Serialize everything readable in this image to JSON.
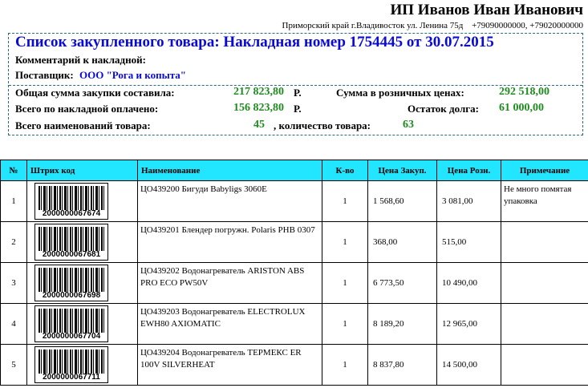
{
  "header": {
    "owner": "ИП Иванов Иван Иванович",
    "address": "Приморский край г.Владивосток ул. Ленина 75д",
    "phones": "+79090000000, +79020000000"
  },
  "invoice": {
    "title": "Список закупленного товара: Накладная номер 1754445 от 30.07.2015",
    "comment_label": "Комментарий к накладной:",
    "supplier_label": "Поставщик:",
    "supplier_value": "ООО \"Рога и копыта\""
  },
  "summary": {
    "total_purchase_label": "Общая сумма закупки составила:",
    "total_purchase_value": "217 823,80",
    "total_purchase_currency": "Р.",
    "retail_label": "Сумма в розничных ценах:",
    "retail_value": "292 518,00",
    "paid_label": "Всего по накладной оплачено:",
    "paid_value": "156 823,80",
    "paid_currency": "Р.",
    "debt_label": "Остаток долга:",
    "debt_value": "61 000,00",
    "items_label": "Всего наименований товара:",
    "items_value": "45",
    "qty_label": ", количество товара:",
    "qty_value": "63"
  },
  "table": {
    "columns": [
      "№",
      "Штрих код",
      "Наименование",
      "К-во",
      "Цена Закуп.",
      "Цена Розн.",
      "Примечание"
    ],
    "rows": [
      {
        "n": "1",
        "barcode": "2000000067674",
        "name": "ЦО439200 Бигуди Babyligs 3060E",
        "qty": "1",
        "buy": "1 568,60",
        "retail": "3 081,00",
        "note": "Не много помятая упаковка"
      },
      {
        "n": "2",
        "barcode": "2000000067681",
        "name": "ЦО439201 Блендер погружн. Polaris PHB 0307",
        "qty": "1",
        "buy": "368,00",
        "retail": "515,00",
        "note": ""
      },
      {
        "n": "3",
        "barcode": "2000000067698",
        "name": "ЦО439202 Водонагреватель ARISTON ABS PRO ECO PW50V",
        "qty": "1",
        "buy": "6 773,50",
        "retail": "10 490,00",
        "note": ""
      },
      {
        "n": "4",
        "barcode": "2000000067704",
        "name": "ЦО439203 Водонагреватель ELECTROLUX EWH80 AXIOMATIC",
        "qty": "1",
        "buy": "8 189,20",
        "retail": "12 965,00",
        "note": ""
      },
      {
        "n": "5",
        "barcode": "2000000067711",
        "name": "ЦО439204 Водонагреватель ТЕРМЕКС ER 100V SILVERHEAT",
        "qty": "1",
        "buy": "8 837,80",
        "retail": "14 500,00",
        "note": ""
      }
    ]
  }
}
